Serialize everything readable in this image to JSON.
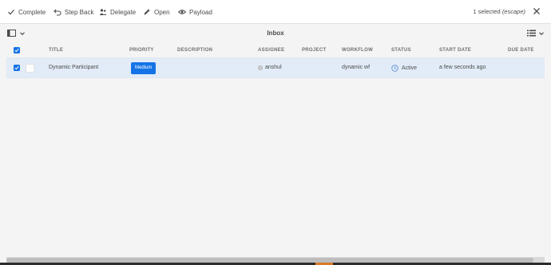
{
  "actionbar": {
    "complete": "Complete",
    "step_back": "Step Back",
    "delegate": "Delegate",
    "open": "Open",
    "payload": "Payload",
    "selected_text": "1 selected",
    "escape_hint": "(escape)"
  },
  "titlebar": {
    "title": "Inbox"
  },
  "table": {
    "headers": [
      "TITLE",
      "PRIORITY",
      "DESCRIPTION",
      "ASSIGNEE",
      "PROJECT",
      "WORKFLOW",
      "STATUS",
      "START DATE",
      "DUE DATE"
    ],
    "rows": [
      {
        "selected": true,
        "title": "Dynamic Participant",
        "priority": "Medium",
        "description": "",
        "assignee": "anshul",
        "project": "",
        "workflow": "dynamic wf",
        "status": "Active",
        "start_date": "a few seconds ago",
        "due_date": ""
      }
    ]
  },
  "colors": {
    "accent": "#1473e6",
    "row_selected": "#e2ecf8",
    "background": "#f4f4f4"
  },
  "icons": {
    "complete": "checkmark-icon",
    "step_back": "step-back-icon",
    "delegate": "delegate-icon",
    "open": "edit-pencil-icon",
    "payload": "eye-icon",
    "close": "close-icon",
    "rail": "rail-toggle-icon",
    "view": "list-view-icon",
    "status": "clock-icon"
  }
}
